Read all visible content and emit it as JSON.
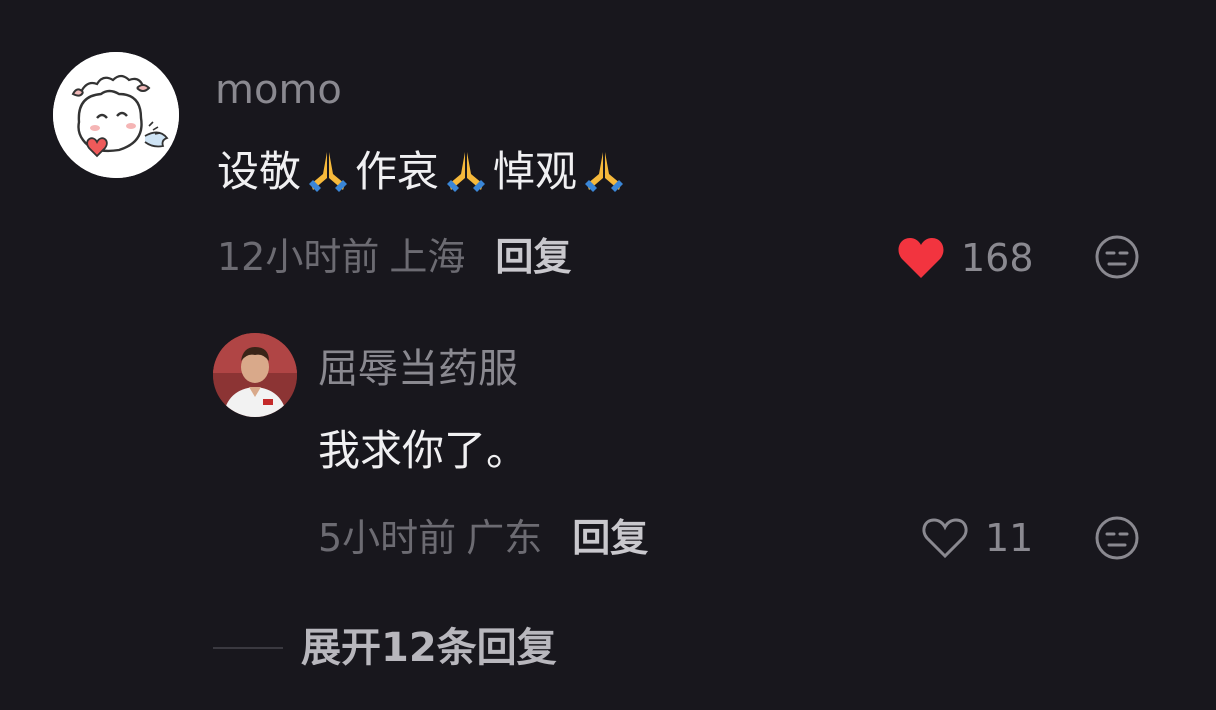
{
  "comment": {
    "username": "momo",
    "text_parts": [
      "设敬",
      "作哀",
      "悼观"
    ],
    "emoji": "folded-hands-emoji",
    "time": "12小时前",
    "location": "上海",
    "reply_label": "回复",
    "likes": "168",
    "liked": true
  },
  "reply": {
    "username": "屈辱当药服",
    "text": "我求你了。",
    "time": "5小时前",
    "location": "广东",
    "reply_label": "回复",
    "likes": "11",
    "liked": false
  },
  "expand_label": "展开12条回复",
  "colors": {
    "background": "#18171d",
    "like_red": "#f2343f",
    "muted": "#6c6b72"
  }
}
